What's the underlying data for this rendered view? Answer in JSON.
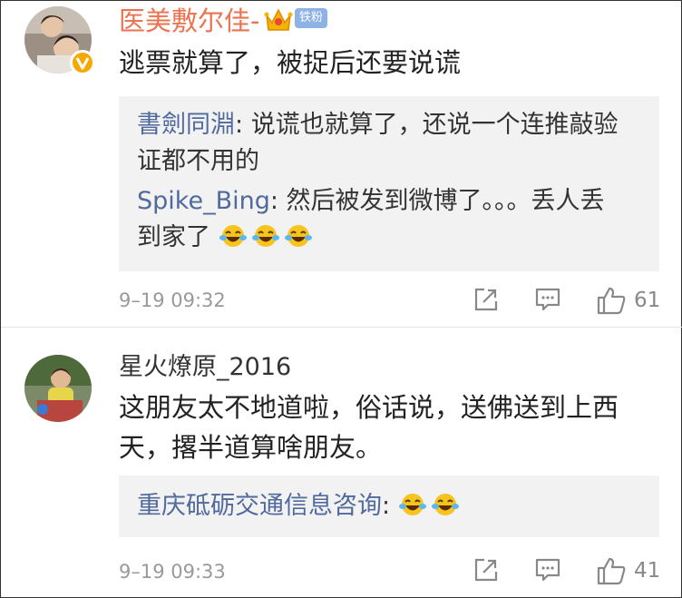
{
  "comments": [
    {
      "username": "医美敷尔佳-",
      "badge": "铁粉",
      "text_lines": [
        "逃票就算了，被捉后还要说谎"
      ],
      "replies": [
        {
          "name": "書劍同淵",
          "sep": ": ",
          "line1": "说谎也就算了，还说一个连推敲验",
          "line2": "证都不用的"
        },
        {
          "name": "Spike_Bing",
          "sep": ": ",
          "line1": "然后被发到微博了。。。丢人丢",
          "line2": "到家了"
        }
      ],
      "time": "9–19 09:32",
      "likes": "61"
    },
    {
      "username": "星火燎原_2016",
      "text_lines": [
        "这朋友太不地道啦，俗话说，送佛送到上西",
        "天，撂半道算啥朋友。"
      ],
      "replies": [
        {
          "name": "重庆砥砺交通信息咨询",
          "sep": ": "
        }
      ],
      "time": "9–19 09:33",
      "likes": "41"
    }
  ],
  "icons": {
    "share": "share-icon",
    "comment": "comment-icon",
    "like": "thumbs-up-icon",
    "emoji": "laugh-cry-emoji",
    "verified": "verified-badge-icon",
    "crown": "crown-icon"
  },
  "colors": {
    "username_highlight": "#eb7350",
    "reply_name": "#506a9e",
    "reply_bg": "#f2f2f2",
    "verified": "#f7a800",
    "fan_badge": "#8cb2e6"
  }
}
